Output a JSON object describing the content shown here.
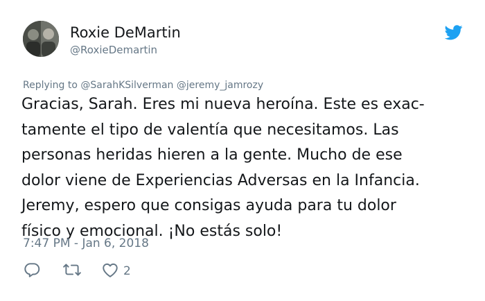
{
  "tweet": {
    "author_name": "Roxie DeMartin",
    "author_handle": "@RoxieDemartin",
    "replying_label": "Replying to",
    "reply_mentions": [
      "@SarahKSilverman",
      "@jeremy_jamrozy"
    ],
    "body_lines": [
      "Gracias, Sarah. Eres mi nueva heroína. Este es exac-",
      "tamente el tipo de valentía que necesitamos. Las",
      "personas heridas hieren a la gente. Mucho de ese",
      "dolor viene de Experiencias Adversas en la Infancia.",
      "Jeremy, espero que consigas ayuda para tu dolor",
      "físico y emocional. ¡No estás solo!"
    ],
    "timestamp": "7:47 PM - Jan 6, 2018",
    "like_count": "2",
    "icons": {
      "brand": "twitter-bird-icon",
      "reply": "reply-icon",
      "retweet": "retweet-icon",
      "like": "heart-icon"
    },
    "colors": {
      "brand_blue": "#1da1f2",
      "muted_gray": "#657786",
      "text": "#14171a"
    }
  }
}
